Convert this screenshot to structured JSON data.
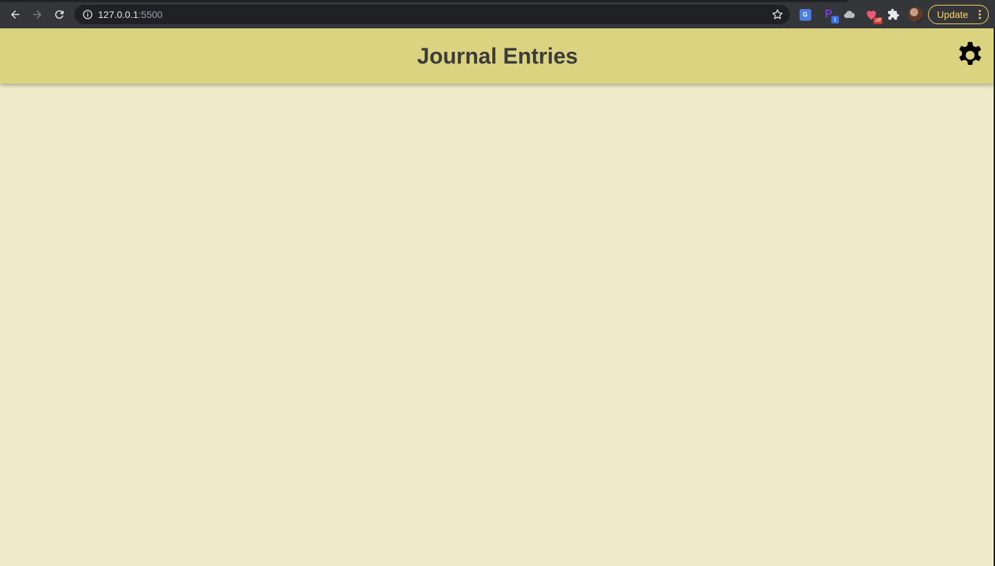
{
  "browser": {
    "url_host": "127.0.0.1",
    "url_port": ":5500",
    "update_label": "Update",
    "extensions": {
      "translate_label": "G",
      "p_label": "P",
      "p_badge": "1",
      "heart_badge": "off"
    },
    "icons": [
      "back-icon",
      "forward-icon",
      "reload-icon",
      "info-icon",
      "star-icon",
      "translate-icon",
      "cloud-icon",
      "heart-icon",
      "puzzle-icon",
      "more-icon",
      "gear-icon"
    ]
  },
  "header": {
    "title": "Journal Entries"
  },
  "colors": {
    "page_background": "#efebca",
    "header_background": "#dbd37f",
    "title_color": "#3c3c3c",
    "update_accent": "#fdd663"
  }
}
